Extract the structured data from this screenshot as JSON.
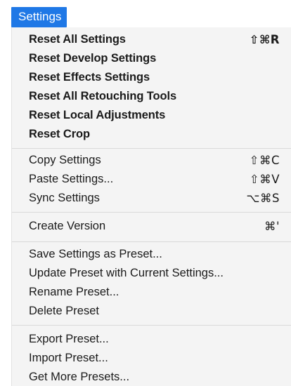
{
  "menu": {
    "title": "Settings"
  },
  "groups": [
    {
      "items": [
        {
          "label": "Reset All Settings",
          "shortcut": "⇧⌘R"
        },
        {
          "label": "Reset Develop Settings",
          "shortcut": ""
        },
        {
          "label": "Reset Effects Settings",
          "shortcut": ""
        },
        {
          "label": "Reset All Retouching Tools",
          "shortcut": ""
        },
        {
          "label": "Reset Local Adjustments",
          "shortcut": ""
        },
        {
          "label": "Reset Crop",
          "shortcut": ""
        }
      ]
    },
    {
      "items": [
        {
          "label": "Copy Settings",
          "shortcut": "⇧⌘C"
        },
        {
          "label": "Paste Settings...",
          "shortcut": "⇧⌘V"
        },
        {
          "label": "Sync Settings",
          "shortcut": "⌥⌘S"
        }
      ]
    },
    {
      "items": [
        {
          "label": "Create Version",
          "shortcut": "⌘'"
        }
      ]
    },
    {
      "items": [
        {
          "label": "Save Settings as Preset...",
          "shortcut": ""
        },
        {
          "label": "Update Preset with Current Settings...",
          "shortcut": ""
        },
        {
          "label": "Rename Preset...",
          "shortcut": ""
        },
        {
          "label": "Delete Preset",
          "shortcut": ""
        }
      ]
    },
    {
      "items": [
        {
          "label": "Export Preset...",
          "shortcut": ""
        },
        {
          "label": "Import Preset...",
          "shortcut": ""
        },
        {
          "label": "Get More Presets...",
          "shortcut": ""
        }
      ]
    }
  ],
  "colors": {
    "highlight": "#1f78e6",
    "menu_background": "#f4f4f4",
    "separator": "#d9d9d9",
    "text": "#1a1a1a"
  }
}
